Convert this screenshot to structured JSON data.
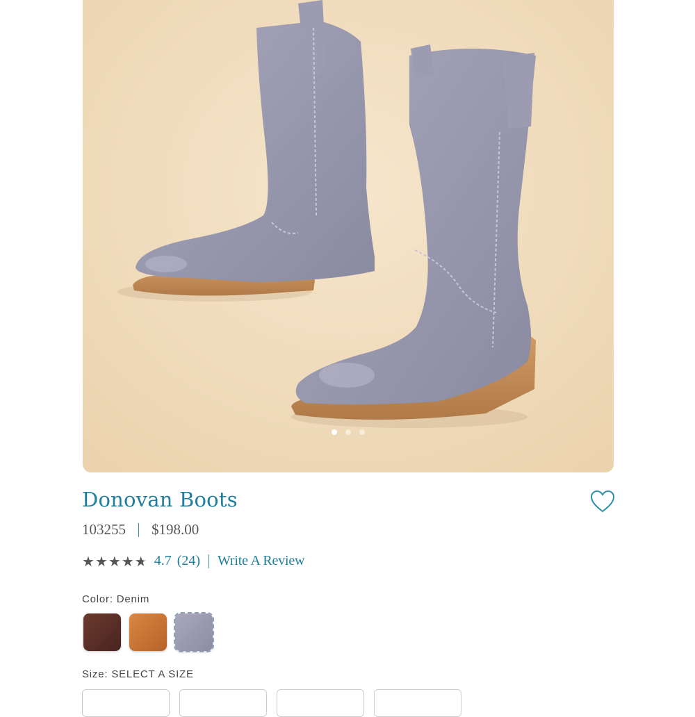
{
  "product": {
    "title": "Donovan Boots",
    "sku": "103255",
    "price": "$198.00",
    "rating": {
      "value": "4.7",
      "count": "(24)",
      "stars_filled": 4.7,
      "write_review_label": "Write A Review"
    }
  },
  "carousel": {
    "dot_count": 3,
    "active_index": 0
  },
  "color": {
    "label": "Color: Denim",
    "options": [
      {
        "name": "brown",
        "hex": "#5a2f26"
      },
      {
        "name": "tan",
        "hex": "#c8733a"
      },
      {
        "name": "denim",
        "hex": "#9b9ab0",
        "selected": true
      }
    ]
  },
  "size": {
    "label": "Size: SELECT A SIZE"
  },
  "icons": {
    "wishlist": "heart-outline-icon",
    "star": "star-icon"
  },
  "colors": {
    "accent": "#1f7f9a",
    "hero_background": "#f1dfc2",
    "boot_suede": "#a09fb5",
    "sole": "#c48d58"
  }
}
